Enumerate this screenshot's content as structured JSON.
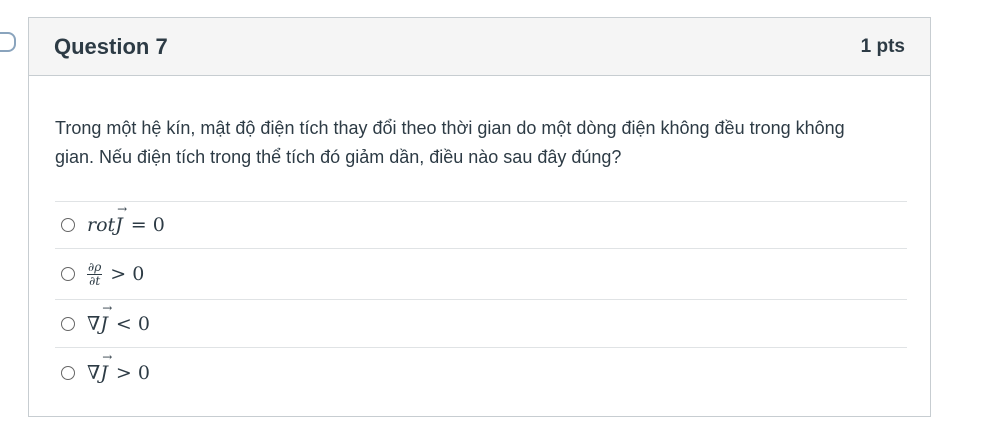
{
  "question": {
    "title": "Question 7",
    "points": "1 pts",
    "text": "Trong một hệ kín, mật độ điện tích thay đổi theo thời gian do một dòng điện không đều trong không gian. Nếu điện tích trong thể tích đó giảm dần, điều nào sau đây đúng?"
  },
  "answers": [
    {
      "prefix": "rot",
      "var": "J",
      "rel": "= 0"
    },
    {
      "num": "∂ρ",
      "den": "∂t",
      "rel": "> 0"
    },
    {
      "prefix": "∇",
      "var": "J",
      "rel": "< 0"
    },
    {
      "prefix": "∇",
      "var": "J",
      "rel": "> 0"
    }
  ]
}
